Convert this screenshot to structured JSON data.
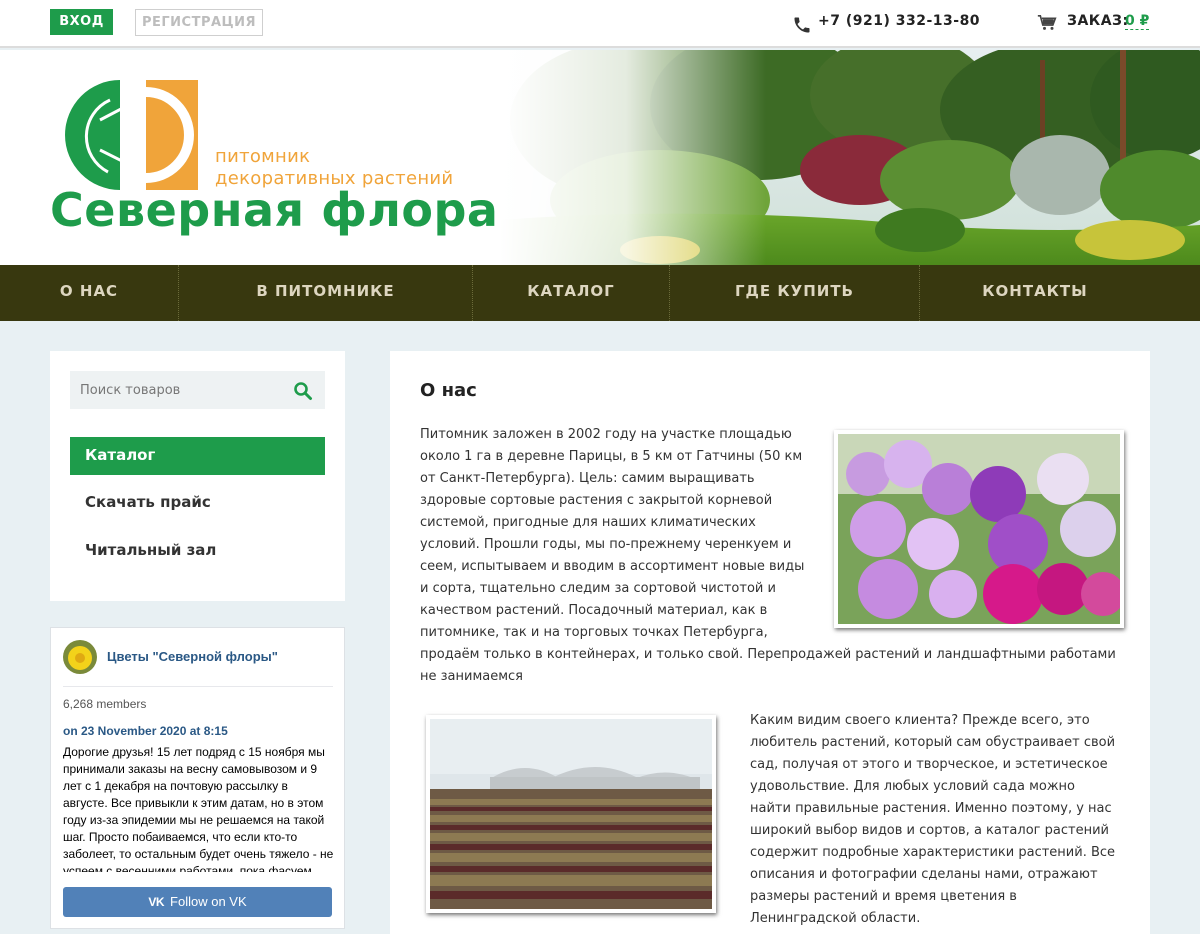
{
  "topbar": {
    "login_label": "ВХОД",
    "register_label": "РЕГИСТРАЦИЯ",
    "phone": "+7 (921) 332-13-80",
    "order_label": "ЗАКАЗ:",
    "order_value": "0 ₽"
  },
  "logo": {
    "subtitle_line1": "питомник",
    "subtitle_line2": "декоративных растений",
    "title": "Северная флора"
  },
  "nav": {
    "items": [
      "О НАС",
      "В ПИТОМНИКЕ",
      "КАТАЛОГ",
      "ГДЕ КУПИТЬ",
      "КОНТАКТЫ"
    ]
  },
  "sidebar": {
    "search_placeholder": "Поиск товаров",
    "items": [
      "Каталог",
      "Скачать прайс",
      "Читальный зал"
    ]
  },
  "vk": {
    "group_name": "Цветы \"Северной флоры\"",
    "members": "6,268 members",
    "post_date": "on 23 November 2020 at 8:15",
    "post_text": "Дорогие друзья! 15 лет подряд с 15 ноября мы принимали заказы на весну самовывозом и 9 лет с 1 декабря на почтовую рассылку в августе. Все привыкли к этим датам, но в этом году из-за эпидемии мы не решаемся на такой шаг. Просто побаиваемся, что если кто-то заболеет, то остальным будет очень тяжело - не успеем с весенними работами, пока фасуем заказы.",
    "follow_logo": "VK",
    "follow_label": "Follow on VK"
  },
  "content": {
    "title": "О нас",
    "paragraph1": "Питомник заложен в 2002 году на участке площадью около 1 га в деревне Парицы, в 5 км от Гатчины (50 км от Санкт-Петербурга). Цель: самим выращивать здоровые сортовые растения с закрытой корневой системой, пригодные для наших климатических условий. Прошли годы, мы по-прежнему черенкуем и сеем, испытываем и вводим в ассортимент новые виды и сорта, тщательно следим за сортовой чистотой и качеством растений. Посадочный материал, как в питомнике, так и на торговых точках Петербурга, продаём только в контейнерах, и только свой. Перепродажей растений и ландшафтными работами не занимаемся",
    "paragraph2": "Каким видим своего клиента? Прежде всего, это любитель растений, который сам обустраивает свой сад, получая от этого и творческое, и эстетическое удовольствие. Для любых условий сада можно найти правильные растения. Именно поэтому, у нас широкий выбор видов и сортов, а каталог растений содержит подробные характеристики растений. Все описания и фотографии сделаны нами, отражают размеры растений и время цветения в Ленинградской области."
  },
  "colors": {
    "brand_green": "#1e9c4b",
    "logo_orange": "#f0a43a",
    "nav_bg": "#38380f",
    "vk_blue": "#5181b8"
  },
  "icons": {
    "phone": "phone-icon",
    "cart": "cart-icon",
    "search": "search-icon"
  }
}
